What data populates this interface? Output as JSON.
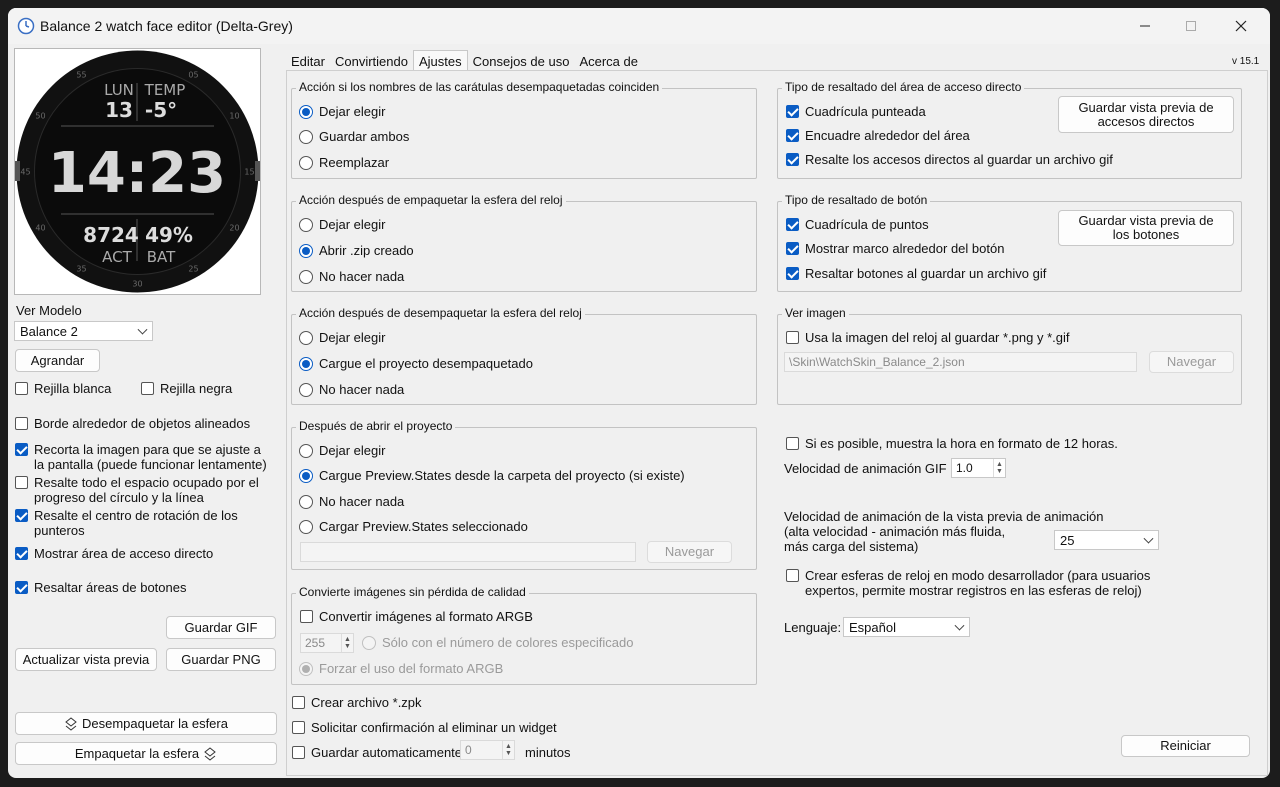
{
  "window": {
    "title": "Balance 2 watch face editor (Delta-Grey)",
    "version": "v 15.1"
  },
  "watch": {
    "top_left_label": "LUN",
    "top_left_value": "13",
    "top_right_label": "TEMP",
    "top_right_value": "-5°",
    "time": "14:23",
    "bottom_left_value": "8724",
    "bottom_left_label": "ACT",
    "bottom_right_value": "49%",
    "bottom_right_label": "BAT",
    "ticks": [
      "05",
      "10",
      "15",
      "20",
      "25",
      "30",
      "35",
      "40",
      "45",
      "50",
      "55"
    ]
  },
  "left": {
    "model_label": "Ver Modelo",
    "model_value": "Balance 2",
    "zoom_button": "Agrandar",
    "white_grid": "Rejilla blanca",
    "black_grid": "Rejilla negra",
    "border_aligned": "Borde alrededor de objetos alineados",
    "crop_image": "Recorta la imagen para que se ajuste a la pantalla (puede funcionar lentamente)",
    "highlight_space": "Resalte todo el espacio ocupado por el progreso del círculo y la línea",
    "highlight_center": "Resalte el centro de rotación de los punteros",
    "show_shortcut_area": "Mostrar área de acceso directo",
    "highlight_buttons": "Resaltar áreas de botones",
    "save_gif": "Guardar GIF",
    "update_preview": "Actualizar vista previa",
    "save_png": "Guardar PNG",
    "unpack": "Desempaquetar la esfera",
    "pack": "Empaquetar la esfera",
    "checks": {
      "white_grid": false,
      "black_grid": false,
      "border_aligned": false,
      "crop_image": true,
      "highlight_space": false,
      "highlight_center": true,
      "show_shortcut_area": true,
      "highlight_buttons": true
    }
  },
  "tabs": [
    "Editar",
    "Convirtiendo",
    "Ajustes",
    "Consejos de uso",
    "Acerca de"
  ],
  "active_tab": "Ajustes",
  "settings": {
    "g1": {
      "title": "Acción si los nombres de las carátulas desempaquetadas coinciden",
      "options": [
        "Dejar elegir",
        "Guardar ambos",
        "Reemplazar"
      ],
      "selected": 0
    },
    "g2": {
      "title": "Acción después de empaquetar la esfera del reloj",
      "options": [
        "Dejar elegir",
        "Abrir .zip creado",
        "No hacer nada"
      ],
      "selected": 1
    },
    "g3": {
      "title": "Acción después de desempaquetar la esfera del reloj",
      "options": [
        "Dejar elegir",
        "Cargue el proyecto desempaquetado",
        "No hacer nada"
      ],
      "selected": 1
    },
    "g4": {
      "title": "Después de abrir el proyecto",
      "options": [
        "Dejar elegir",
        "Cargue Preview.States desde la carpeta del proyecto (si existe)",
        "No hacer nada",
        "Cargar Preview.States seleccionado"
      ],
      "selected": 1,
      "navigate": "Navegar"
    },
    "g5": {
      "title": "Convierte imágenes sin pérdida de calidad",
      "convert_argb": "Convertir imágenes al formato ARGB",
      "color_count": "255",
      "only_colors": "Sólo con el número de colores especificado",
      "force_argb": "Forzar el uso del formato ARGB"
    },
    "create_zpk": "Crear archivo *.zpk",
    "confirm_delete": "Solicitar confirmación al eliminar un widget",
    "autosave": "Guardar automaticamente",
    "autosave_value": "0",
    "minutes": "minutos",
    "g6": {
      "title": "Tipo de resaltado del área de acceso directo",
      "dotted_grid": "Cuadrícula punteada",
      "frame_area": "Encuadre alrededor del área",
      "highlight_gif": "Resalte los accesos directos al guardar un archivo gif",
      "save_preview": "Guardar vista previa de accesos directos"
    },
    "g7": {
      "title": "Tipo de resaltado de botón",
      "dot_grid": "Cuadrícula de puntos",
      "frame_button": "Mostrar marco alrededor del botón",
      "highlight_gif": "Resaltar botones al guardar un archivo gif",
      "save_preview": "Guardar vista previa de los botones"
    },
    "g8": {
      "title": "Ver imagen",
      "use_image": "Usa la imagen del reloj al guardar *.png y *.gif",
      "path": "\\Skin\\WatchSkin_Balance_2.json",
      "navigate": "Navegar"
    },
    "twelve_hour": "Si es posible, muestra la hora en formato de 12 horas.",
    "gif_speed_label": "Velocidad de animación GIF",
    "gif_speed_value": "1.0",
    "anim_speed_label": "Velocidad de animación de la vista previa de animación\n(alta velocidad - animación más fluida,\nmás carga del sistema)",
    "anim_speed_value": "25",
    "dev_mode": "Crear esferas de reloj en modo desarrollador (para usuarios expertos, permite mostrar registros en las esferas de reloj)",
    "language_label": "Lenguaje:",
    "language_value": "Español",
    "reset": "Reiniciar"
  }
}
